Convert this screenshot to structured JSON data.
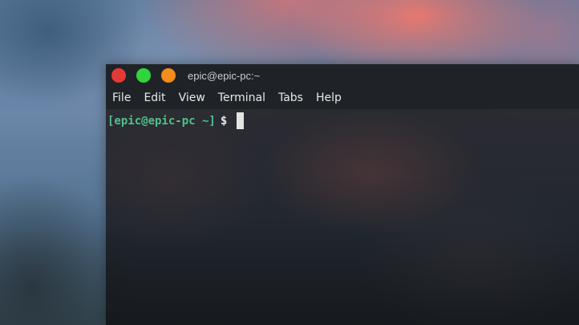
{
  "window": {
    "title": "epic@epic-pc:~",
    "buttons": [
      {
        "name": "close",
        "color": "#e53935"
      },
      {
        "name": "maximize",
        "color": "#2fd63a"
      },
      {
        "name": "minimize",
        "color": "#f28c1c"
      }
    ]
  },
  "menubar": {
    "items": [
      "File",
      "Edit",
      "View",
      "Terminal",
      "Tabs",
      "Help"
    ]
  },
  "terminal": {
    "prompt": "[epic@epic-pc ~]",
    "prompt_symbol": "$",
    "prompt_color": "#4fc08d"
  }
}
